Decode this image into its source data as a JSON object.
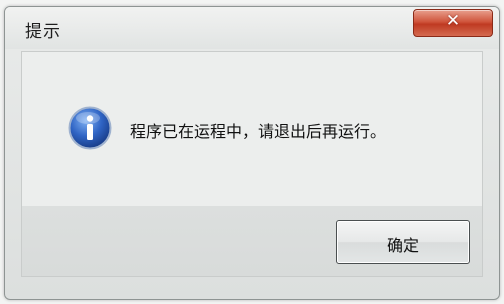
{
  "dialog": {
    "title": "提示",
    "close_label": "✕",
    "message": "程序已在运程中，请退出后再运行。",
    "icon": "info-icon",
    "ok_label": "确定"
  }
}
